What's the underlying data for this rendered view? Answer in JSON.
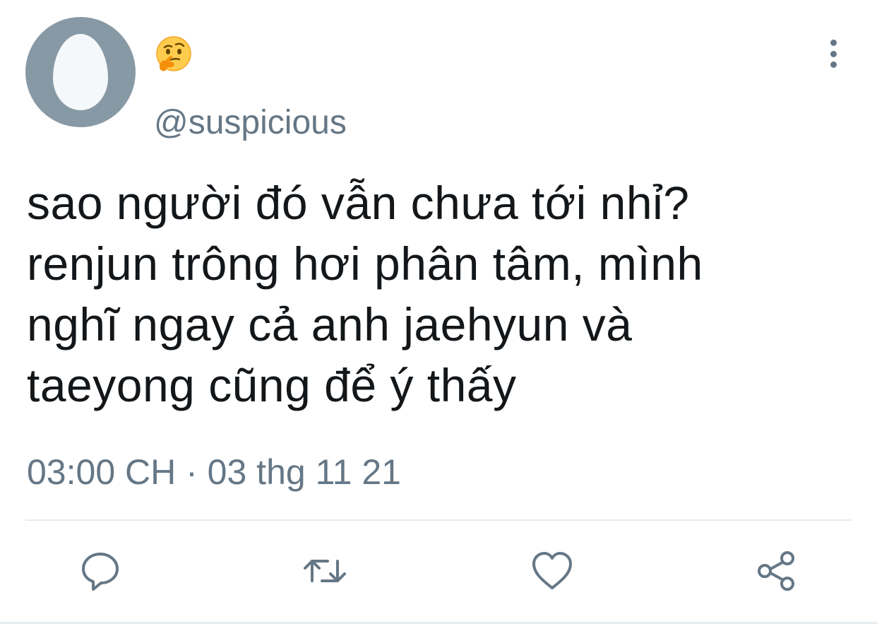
{
  "tweet": {
    "display_name_icon": "thinking-face-emoji",
    "handle": "@suspicious",
    "text_lines": [
      "sao người đó vẫn chưa tới nhỉ?",
      "renjun trông hơi phân tâm, mình",
      "nghĩ ngay cả anh jaehyun và",
      "taeyong cũng để ý thấy"
    ],
    "timestamp": "03:00 CH · 03 thg 11 21"
  },
  "actions": [
    {
      "name": "reply",
      "icon": "speech-bubble-icon"
    },
    {
      "name": "retweet",
      "icon": "retweet-icon"
    },
    {
      "name": "like",
      "icon": "heart-icon"
    },
    {
      "name": "share",
      "icon": "share-icon"
    }
  ],
  "colors": {
    "text": "#14171a",
    "secondary": "#657786",
    "avatar_bg": "#8899a6",
    "divider": "#e6ecf0"
  }
}
